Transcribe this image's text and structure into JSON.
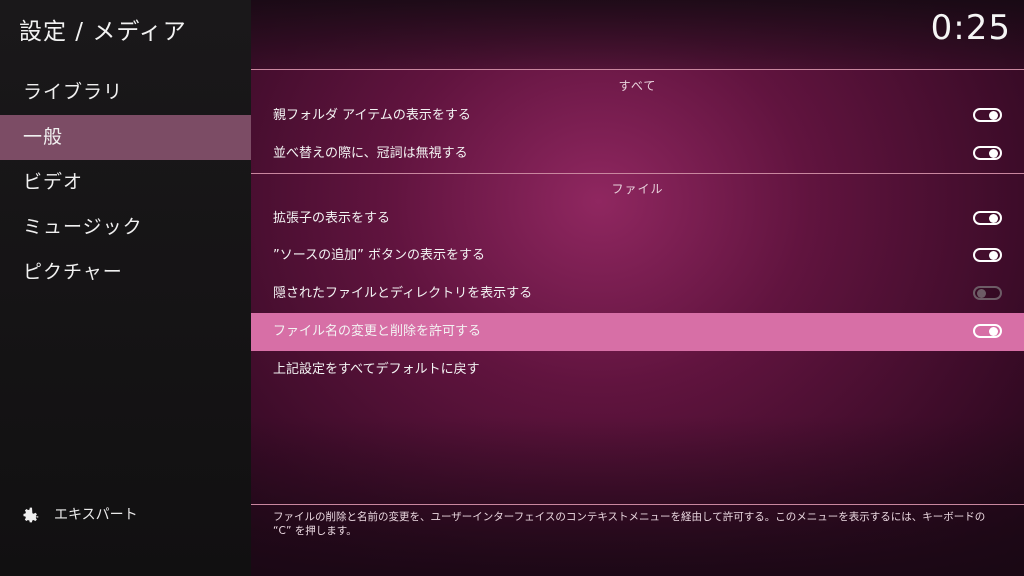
{
  "header": {
    "title": "設定 / メディア",
    "clock": "0:25"
  },
  "sidebar": {
    "items": [
      {
        "label": "ライブラリ",
        "active": false
      },
      {
        "label": "一般",
        "active": true
      },
      {
        "label": "ビデオ",
        "active": false
      },
      {
        "label": "ミュージック",
        "active": false
      },
      {
        "label": "ピクチャー",
        "active": false
      }
    ],
    "expert_label": "エキスパート"
  },
  "sections": {
    "all": {
      "label": "すべて",
      "items": [
        {
          "label": "親フォルダ アイテムの表示をする",
          "toggle": "on"
        },
        {
          "label": "並べ替えの際に、冠詞は無視する",
          "toggle": "on"
        }
      ]
    },
    "files": {
      "label": "ファイル",
      "items": [
        {
          "label": "拡張子の表示をする",
          "toggle": "on"
        },
        {
          "label": "”ソースの追加” ボタンの表示をする",
          "toggle": "on"
        },
        {
          "label": "隠されたファイルとディレクトリを表示する",
          "toggle": "off"
        },
        {
          "label": "ファイル名の変更と削除を許可する",
          "toggle": "on",
          "focused": true
        }
      ]
    },
    "reset_label": "上記設定をすべてデフォルトに戻す"
  },
  "help_text": "ファイルの削除と名前の変更を、ユーザーインターフェイスのコンテキストメニューを経由して許可する。このメニューを表示するには、キーボードの “C” を押します。",
  "colors": {
    "accent_focus": "#d76fa6",
    "sidebar_active": "#7c4c65",
    "divider": "#c9879f"
  }
}
